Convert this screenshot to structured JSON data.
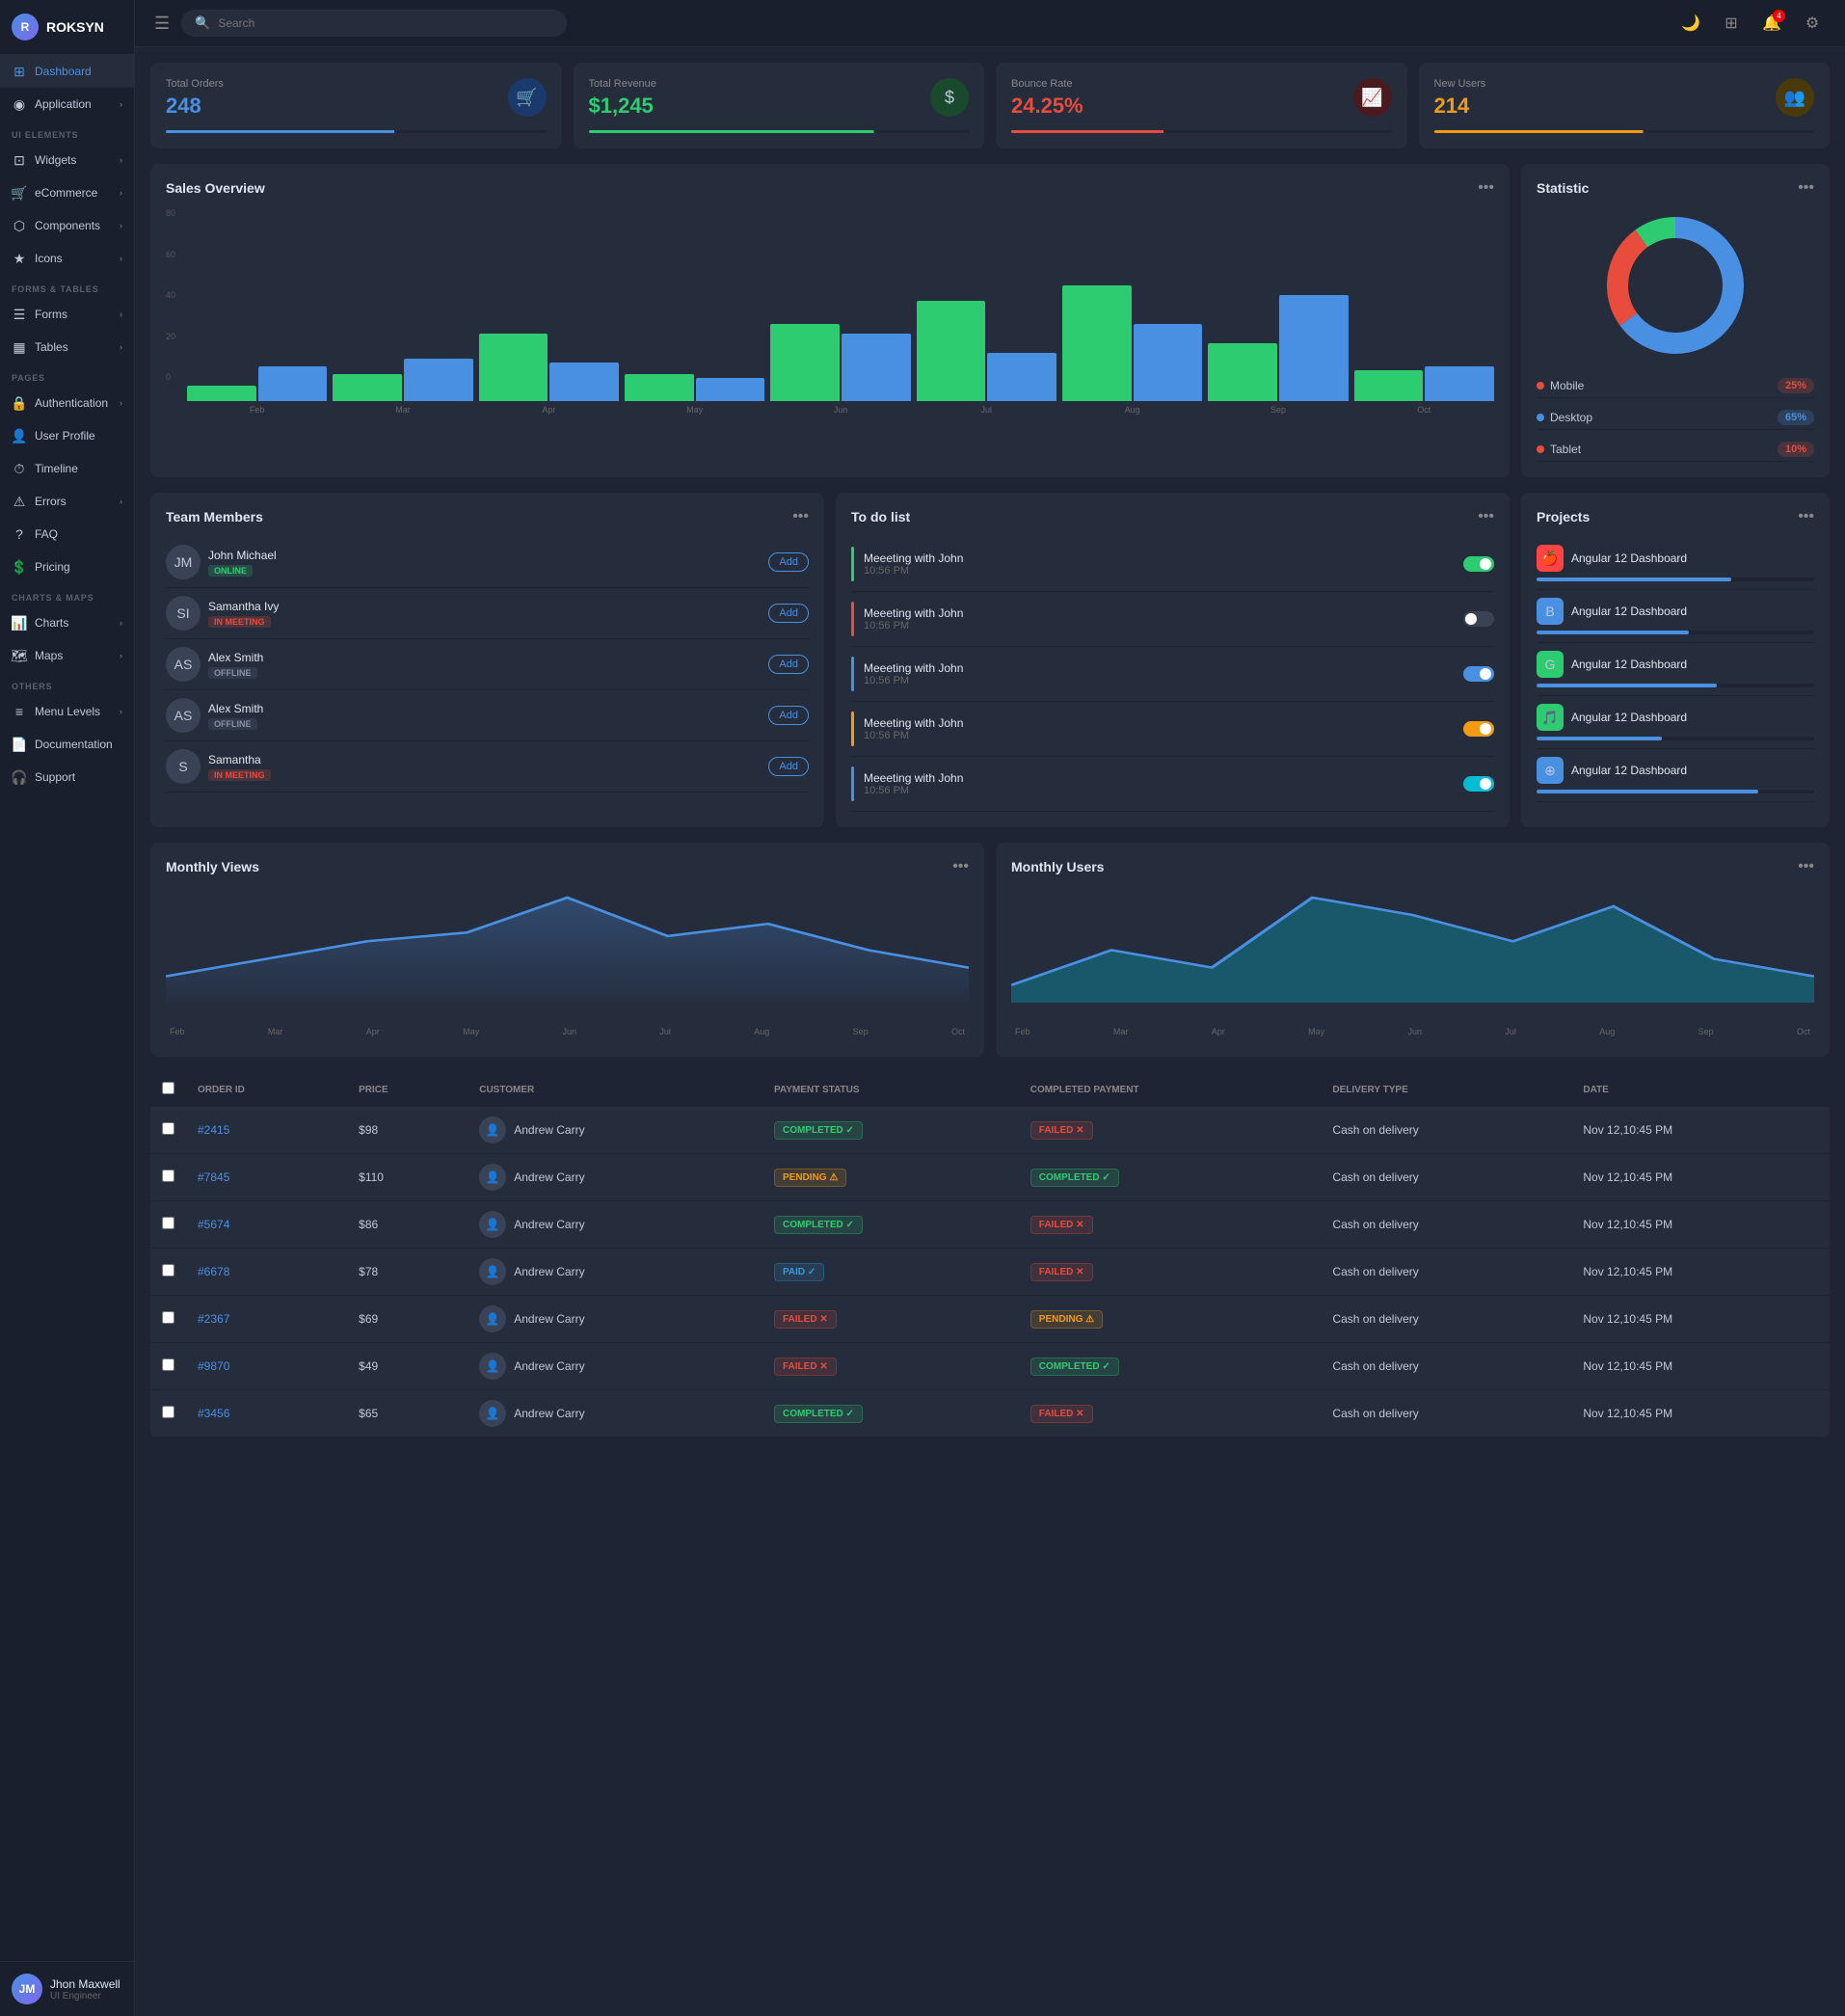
{
  "app": {
    "name": "ROKSYN",
    "logo_initials": "R"
  },
  "topbar": {
    "search_placeholder": "Search",
    "notification_count": "4"
  },
  "sidebar": {
    "active_item": "Dashboard",
    "sections": [
      {
        "label": "",
        "items": [
          {
            "id": "dashboard",
            "label": "Dashboard",
            "icon": "⊞",
            "active": true
          },
          {
            "id": "application",
            "label": "Application",
            "icon": "◉",
            "has_chevron": true
          }
        ]
      },
      {
        "label": "UI ELEMENTS",
        "items": [
          {
            "id": "widgets",
            "label": "Widgets",
            "icon": "⊡",
            "has_chevron": true
          },
          {
            "id": "ecommerce",
            "label": "eCommerce",
            "icon": "🛒",
            "has_chevron": true
          },
          {
            "id": "components",
            "label": "Components",
            "icon": "⬡",
            "has_chevron": true
          },
          {
            "id": "icons",
            "label": "Icons",
            "icon": "★",
            "has_chevron": true
          }
        ]
      },
      {
        "label": "FORMS & TABLES",
        "items": [
          {
            "id": "forms",
            "label": "Forms",
            "icon": "☰",
            "has_chevron": true
          },
          {
            "id": "tables",
            "label": "Tables",
            "icon": "▦",
            "has_chevron": true
          }
        ]
      },
      {
        "label": "PAGES",
        "items": [
          {
            "id": "authentication",
            "label": "Authentication",
            "icon": "🔒",
            "has_chevron": true
          },
          {
            "id": "userprofile",
            "label": "User Profile",
            "icon": "👤"
          },
          {
            "id": "timeline",
            "label": "Timeline",
            "icon": "⏱"
          },
          {
            "id": "errors",
            "label": "Errors",
            "icon": "⚠",
            "has_chevron": true
          },
          {
            "id": "faq",
            "label": "FAQ",
            "icon": "?"
          },
          {
            "id": "pricing",
            "label": "Pricing",
            "icon": "💲"
          }
        ]
      },
      {
        "label": "CHARTS & MAPS",
        "items": [
          {
            "id": "charts",
            "label": "Charts",
            "icon": "📊",
            "has_chevron": true
          },
          {
            "id": "maps",
            "label": "Maps",
            "icon": "🗺",
            "has_chevron": true
          }
        ]
      },
      {
        "label": "OTHERS",
        "items": [
          {
            "id": "menulevels",
            "label": "Menu Levels",
            "icon": "≡",
            "has_chevron": true
          },
          {
            "id": "documentation",
            "label": "Documentation",
            "icon": "📄"
          },
          {
            "id": "support",
            "label": "Support",
            "icon": "🎧"
          }
        ]
      }
    ]
  },
  "stats": [
    {
      "label": "Total Orders",
      "value": "248",
      "color": "#4a90e2",
      "icon": "🛒",
      "icon_bg": "#1a3a6e",
      "bar_color": "#4a90e2",
      "bar_width": "60%"
    },
    {
      "label": "Total Revenue",
      "value": "$1,245",
      "color": "#2ecc71",
      "icon": "$",
      "icon_bg": "#1a4a2e",
      "bar_color": "#2ecc71",
      "bar_width": "75%"
    },
    {
      "label": "Bounce Rate",
      "value": "24.25%",
      "color": "#e74c3c",
      "icon": "📈",
      "icon_bg": "#4a1a1e",
      "bar_color": "#e74c3c",
      "bar_width": "40%"
    },
    {
      "label": "New Users",
      "value": "214",
      "color": "#f39c12",
      "icon": "👥",
      "icon_bg": "#4a3a0a",
      "bar_color": "#f39c12",
      "bar_width": "55%"
    }
  ],
  "sales_overview": {
    "title": "Sales Overview",
    "months": [
      "Feb",
      "Mar",
      "Apr",
      "May",
      "Jun",
      "Jul",
      "Aug",
      "Sep",
      "Oct"
    ],
    "series1": [
      8,
      14,
      35,
      14,
      40,
      52,
      60,
      30,
      16
    ],
    "series2": [
      18,
      22,
      20,
      12,
      35,
      25,
      40,
      55,
      18
    ]
  },
  "statistic": {
    "title": "Statistic",
    "donut": {
      "mobile": 25,
      "desktop": 65,
      "tablet": 10
    },
    "legend": [
      {
        "label": "Mobile",
        "color": "#e74c3c",
        "pct": "25%",
        "pct_bg": "rgba(231,76,60,0.2)",
        "pct_color": "#e74c3c"
      },
      {
        "label": "Desktop",
        "color": "#4a90e2",
        "pct": "65%",
        "pct_bg": "rgba(74,144,226,0.2)",
        "pct_color": "#4a90e2"
      },
      {
        "label": "Tablet",
        "color": "#e74c3c",
        "pct": "10%",
        "pct_bg": "rgba(231,76,60,0.2)",
        "pct_color": "#e74c3c"
      }
    ]
  },
  "team_members": {
    "title": "Team Members",
    "members": [
      {
        "name": "John Michael",
        "status": "ONLINE",
        "status_class": "online",
        "avatar": "JM"
      },
      {
        "name": "Samantha Ivy",
        "status": "IN MEETING",
        "status_class": "inmeeting",
        "avatar": "SI"
      },
      {
        "name": "Alex Smith",
        "status": "OFFLINE",
        "status_class": "offline",
        "avatar": "AS"
      },
      {
        "name": "Alex Smith",
        "status": "OFFLINE",
        "status_class": "offline",
        "avatar": "AS"
      },
      {
        "name": "Samantha",
        "status": "IN MEETING",
        "status_class": "inmeeting",
        "avatar": "S"
      }
    ],
    "add_label": "Add"
  },
  "todo_list": {
    "title": "To do list",
    "items": [
      {
        "title": "Meeeting with John",
        "time": "10:56 PM",
        "color": "#2ecc71",
        "toggle_on": true,
        "toggle_color": "#2ecc71"
      },
      {
        "title": "Meeeting with John",
        "time": "10:56 PM",
        "color": "#e74c3c",
        "toggle_on": false,
        "toggle_color": "#e74c3c"
      },
      {
        "title": "Meeeting with John",
        "time": "10:56 PM",
        "color": "#4a90e2",
        "toggle_on": true,
        "toggle_color": "#4a90e2"
      },
      {
        "title": "Meeeting with John",
        "time": "10:56 PM",
        "color": "#f39c12",
        "toggle_on": true,
        "toggle_color": "#f39c12"
      },
      {
        "title": "Meeeting with John",
        "time": "10:56 PM",
        "color": "#4a90e2",
        "toggle_on": true,
        "toggle_color": "#00bcd4"
      }
    ]
  },
  "projects": {
    "title": "Projects",
    "items": [
      {
        "name": "Angular 12 Dashboard",
        "icon": "🍎",
        "icon_bg": "#ff4444",
        "progress": 70,
        "color": "#4a90e2"
      },
      {
        "name": "Angular 12 Dashboard",
        "icon": "B",
        "icon_bg": "#4a90e2",
        "progress": 55,
        "color": "#4a90e2"
      },
      {
        "name": "Angular 12 Dashboard",
        "icon": "G",
        "icon_bg": "#2ecc71",
        "progress": 65,
        "color": "#4a90e2"
      },
      {
        "name": "Angular 12 Dashboard",
        "icon": "🎵",
        "icon_bg": "#2ecc71",
        "progress": 45,
        "color": "#4a90e2"
      },
      {
        "name": "Angular 12 Dashboard",
        "icon": "⊕",
        "icon_bg": "#4a90e2",
        "progress": 80,
        "color": "#4a90e2"
      }
    ]
  },
  "monthly_views": {
    "title": "Monthly Views",
    "months": [
      "Feb",
      "Mar",
      "Apr",
      "May",
      "Jun",
      "Jul",
      "Aug",
      "Sep",
      "Oct"
    ],
    "values": [
      15,
      25,
      35,
      40,
      60,
      38,
      45,
      30,
      20
    ]
  },
  "monthly_users": {
    "title": "Monthly Users",
    "months": [
      "Feb",
      "Mar",
      "Apr",
      "May",
      "Jun",
      "Jul",
      "Aug",
      "Sep",
      "Oct"
    ],
    "values": [
      10,
      30,
      20,
      60,
      50,
      35,
      55,
      25,
      15
    ]
  },
  "orders_table": {
    "columns": [
      "ORDER ID",
      "PRICE",
      "CUSTOMER",
      "PAYMENT STATUS",
      "COMPLETED PAYMENT",
      "DELIVERY TYPE",
      "DATE"
    ],
    "rows": [
      {
        "id": "#2415",
        "price": "$98",
        "customer": "Andrew Carry",
        "payment_status": "COMPLETED",
        "completed": "FAILED",
        "delivery": "Cash on delivery",
        "date": "Nov 12,10:45 PM"
      },
      {
        "id": "#7845",
        "price": "$110",
        "customer": "Andrew Carry",
        "payment_status": "PENDING",
        "completed": "COMPLETED",
        "delivery": "Cash on delivery",
        "date": "Nov 12,10:45 PM"
      },
      {
        "id": "#5674",
        "price": "$86",
        "customer": "Andrew Carry",
        "payment_status": "COMPLETED",
        "completed": "FAILED",
        "delivery": "Cash on delivery",
        "date": "Nov 12,10:45 PM"
      },
      {
        "id": "#6678",
        "price": "$78",
        "customer": "Andrew Carry",
        "payment_status": "PAID",
        "completed": "FAILED",
        "delivery": "Cash on delivery",
        "date": "Nov 12,10:45 PM"
      },
      {
        "id": "#2367",
        "price": "$69",
        "customer": "Andrew Carry",
        "payment_status": "FAILED",
        "completed": "PENDING",
        "delivery": "Cash on delivery",
        "date": "Nov 12,10:45 PM"
      },
      {
        "id": "#9870",
        "price": "$49",
        "customer": "Andrew Carry",
        "payment_status": "FAILED",
        "completed": "COMPLETED",
        "delivery": "Cash on delivery",
        "date": "Nov 12,10:45 PM"
      },
      {
        "id": "#3456",
        "price": "$65",
        "customer": "Andrew Carry",
        "payment_status": "COMPLETED",
        "completed": "FAILED",
        "delivery": "Cash on delivery",
        "date": "Nov 12,10:45 PM"
      }
    ]
  },
  "user": {
    "name": "Jhon Maxwell",
    "role": "UI Engineer",
    "initials": "JM"
  }
}
